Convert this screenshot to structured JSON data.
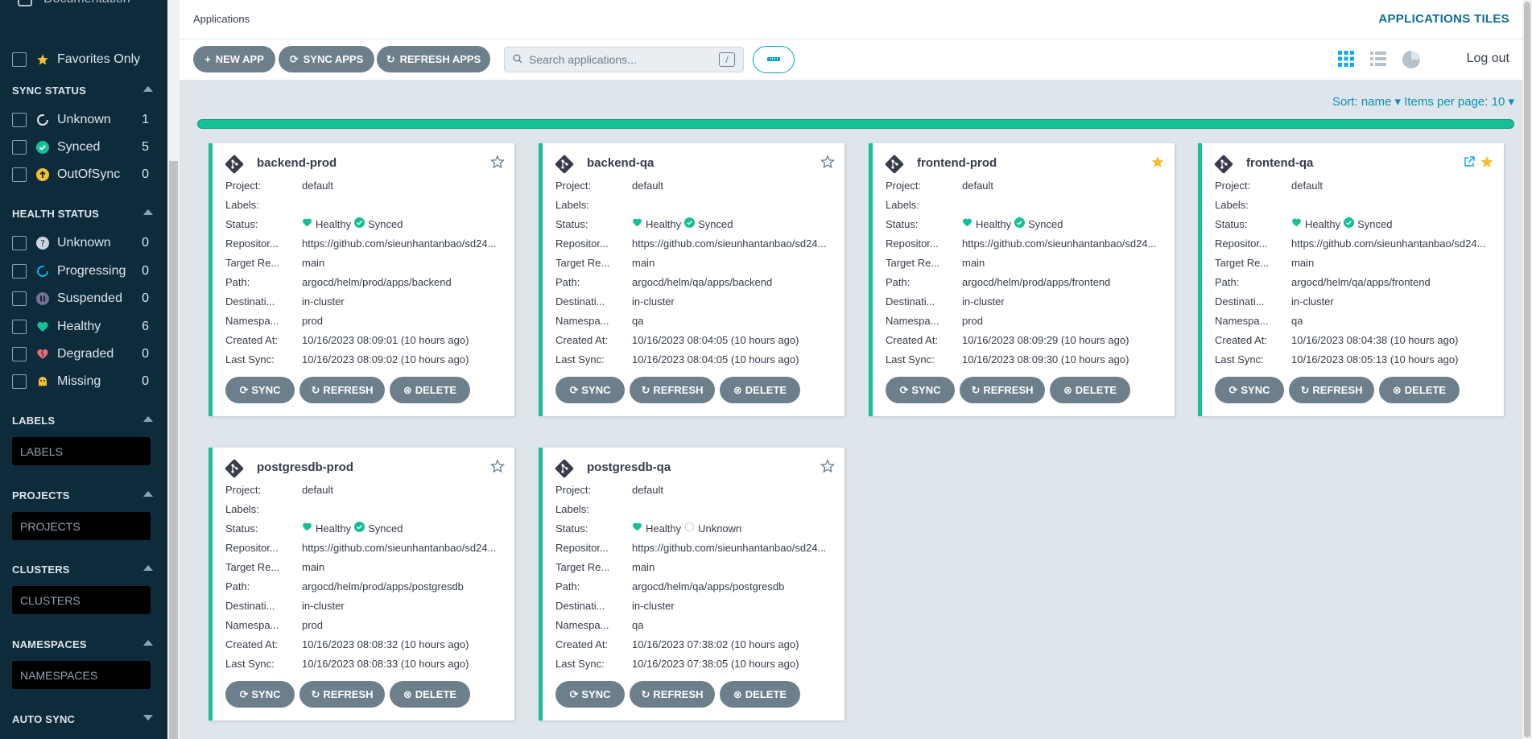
{
  "sidebar": {
    "documentation": "Documentation",
    "favorites": "Favorites Only",
    "sync_status": {
      "title": "SYNC STATUS",
      "items": [
        {
          "label": "Unknown",
          "count": "1"
        },
        {
          "label": "Synced",
          "count": "5"
        },
        {
          "label": "OutOfSync",
          "count": "0"
        }
      ]
    },
    "health_status": {
      "title": "HEALTH STATUS",
      "items": [
        {
          "label": "Unknown",
          "count": "0"
        },
        {
          "label": "Progressing",
          "count": "0"
        },
        {
          "label": "Suspended",
          "count": "0"
        },
        {
          "label": "Healthy",
          "count": "6"
        },
        {
          "label": "Degraded",
          "count": "0"
        },
        {
          "label": "Missing",
          "count": "0"
        }
      ]
    },
    "labels": {
      "title": "LABELS",
      "placeholder": "LABELS"
    },
    "projects": {
      "title": "PROJECTS",
      "placeholder": "PROJECTS"
    },
    "clusters": {
      "title": "CLUSTERS",
      "placeholder": "CLUSTERS"
    },
    "namespaces": {
      "title": "NAMESPACES",
      "placeholder": "NAMESPACES"
    },
    "auto_sync": {
      "title": "AUTO SYNC"
    }
  },
  "topbar": {
    "breadcrumb": "Applications",
    "title": "APPLICATIONS TILES"
  },
  "toolbar": {
    "new_app": "NEW APP",
    "sync_apps": "SYNC APPS",
    "refresh_apps": "REFRESH APPS",
    "search_placeholder": "Search applications...",
    "search_shortcut": "/",
    "logout": "Log out"
  },
  "sort": {
    "text": "Sort: name",
    "per_page": "Items per page: 10"
  },
  "colors": {
    "healthy": "#18be94",
    "favorite": "#f4c030",
    "sidebar": "#0e2b3c",
    "button": "#6d7f8b"
  },
  "card_labels": {
    "project": "Project:",
    "labels": "Labels:",
    "status": "Status:",
    "repo": "Repositor...",
    "target": "Target Re...",
    "path": "Path:",
    "dest": "Destinati...",
    "ns": "Namespa...",
    "created": "Created At:",
    "last_sync": "Last Sync:",
    "sync_btn": "SYNC",
    "refresh_btn": "REFRESH",
    "delete_btn": "DELETE"
  },
  "apps": [
    {
      "name": "backend-prod",
      "project": "default",
      "labels": "",
      "health": "Healthy",
      "sync": "Synced",
      "repo": "https://github.com/sieunhantanbao/sd24...",
      "target": "main",
      "path": "argocd/helm/prod/apps/backend",
      "dest": "in-cluster",
      "ns": "prod",
      "created": "10/16/2023 08:09:01  (10 hours ago)",
      "last_sync": "10/16/2023 08:09:02  (10 hours ago)",
      "favorite": false
    },
    {
      "name": "backend-qa",
      "project": "default",
      "labels": "",
      "health": "Healthy",
      "sync": "Synced",
      "repo": "https://github.com/sieunhantanbao/sd24...",
      "target": "main",
      "path": "argocd/helm/qa/apps/backend",
      "dest": "in-cluster",
      "ns": "qa",
      "created": "10/16/2023 08:04:05  (10 hours ago)",
      "last_sync": "10/16/2023 08:04:05  (10 hours ago)",
      "favorite": false
    },
    {
      "name": "frontend-prod",
      "project": "default",
      "labels": "",
      "health": "Healthy",
      "sync": "Synced",
      "repo": "https://github.com/sieunhantanbao/sd24...",
      "target": "main",
      "path": "argocd/helm/prod/apps/frontend",
      "dest": "in-cluster",
      "ns": "prod",
      "created": "10/16/2023 08:09:29  (10 hours ago)",
      "last_sync": "10/16/2023 08:09:30  (10 hours ago)",
      "favorite": true
    },
    {
      "name": "frontend-qa",
      "project": "default",
      "labels": "",
      "health": "Healthy",
      "sync": "Synced",
      "repo": "https://github.com/sieunhantanbao/sd24...",
      "target": "main",
      "path": "argocd/helm/qa/apps/frontend",
      "dest": "in-cluster",
      "ns": "qa",
      "created": "10/16/2023 08:04:38  (10 hours ago)",
      "last_sync": "10/16/2023 08:05:13  (10 hours ago)",
      "favorite": true,
      "external_link": true
    },
    {
      "name": "postgresdb-prod",
      "project": "default",
      "labels": "",
      "health": "Healthy",
      "sync": "Synced",
      "repo": "https://github.com/sieunhantanbao/sd24...",
      "target": "main",
      "path": "argocd/helm/prod/apps/postgresdb",
      "dest": "in-cluster",
      "ns": "prod",
      "created": "10/16/2023 08:08:32  (10 hours ago)",
      "last_sync": "10/16/2023 08:08:33  (10 hours ago)",
      "favorite": false
    },
    {
      "name": "postgresdb-qa",
      "project": "default",
      "labels": "",
      "health": "Healthy",
      "sync": "Unknown",
      "repo": "https://github.com/sieunhantanbao/sd24...",
      "target": "main",
      "path": "argocd/helm/qa/apps/postgresdb",
      "dest": "in-cluster",
      "ns": "qa",
      "created": "10/16/2023 07:38:02  (10 hours ago)",
      "last_sync": "10/16/2023 07:38:05  (10 hours ago)",
      "favorite": false
    }
  ]
}
